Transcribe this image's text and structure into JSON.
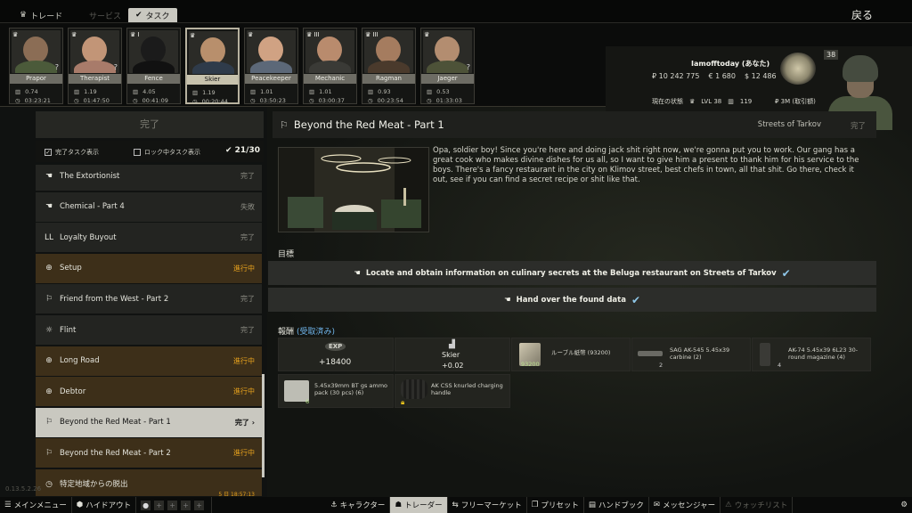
{
  "topbar": {
    "tabs": [
      {
        "label": "トレード",
        "state": "normal"
      },
      {
        "label": "サービス",
        "state": "dim"
      },
      {
        "label": "タスク",
        "state": "active"
      }
    ],
    "back_label": "戻る"
  },
  "traders": [
    {
      "name": "Prapor",
      "rep": "0.74",
      "timer": "03:23:21",
      "skin": "#8b6d55",
      "cloth": "#4b5a3a",
      "level": "",
      "question": "?"
    },
    {
      "name": "Therapist",
      "rep": "1.19",
      "timer": "01:47:50",
      "skin": "#c29577",
      "cloth": "#a87b6a",
      "level": "",
      "question": "?"
    },
    {
      "name": "Fence",
      "rep": "4.05",
      "timer": "00:41:09",
      "skin": "#1b1b1b",
      "cloth": "#111111",
      "level": "I",
      "question": ""
    },
    {
      "name": "Skier",
      "rep": "1.19",
      "timer": "00:20:44",
      "skin": "#b88f6c",
      "cloth": "#2f3b4a",
      "level": "",
      "question": ""
    },
    {
      "name": "Peacekeeper",
      "rep": "1.01",
      "timer": "03:50:23",
      "skin": "#d0a283",
      "cloth": "#5c6878",
      "level": "",
      "question": ""
    },
    {
      "name": "Mechanic",
      "rep": "1.01",
      "timer": "03:00:37",
      "skin": "#b98b6d",
      "cloth": "#3a3a36",
      "level": "III",
      "question": ""
    },
    {
      "name": "Ragman",
      "rep": "0.93",
      "timer": "00:23:54",
      "skin": "#a57c5f",
      "cloth": "#4a3a2c",
      "level": "III",
      "question": ""
    },
    {
      "name": "Jaeger",
      "rep": "0.53",
      "timer": "01:33:03",
      "skin": "#b38d70",
      "cloth": "#4d5238",
      "level": "",
      "question": "?"
    }
  ],
  "profile": {
    "name": "Iamofftoday (あなた)",
    "roubles": "₽ 10 242 775",
    "euros": "€ 1 680",
    "dollars": "$ 12 486",
    "status_label": "現在の状態",
    "level_label": "LVL 38",
    "rep": "119",
    "trader_xp": "₽ 3M (取引額)",
    "level_badge": "38"
  },
  "left_panel": {
    "header": "完了",
    "filter_completed": "完了タスク表示",
    "filter_locked": "ロック中タスク表示",
    "count": "21/30",
    "quests": [
      {
        "name": "The Extortionist",
        "status": "完了",
        "icon": "hand-icon",
        "glyph": "☚",
        "state": "normal",
        "timer": ""
      },
      {
        "name": "Chemical - Part 4",
        "status": "失敗",
        "icon": "hand-icon",
        "glyph": "☚",
        "state": "normal",
        "timer": ""
      },
      {
        "name": "Loyalty Buyout",
        "status": "完了",
        "icon": "loyalty-icon",
        "glyph": "LL",
        "state": "normal",
        "timer": ""
      },
      {
        "name": "Setup",
        "status": "進行中",
        "icon": "crosshair-icon",
        "glyph": "⊕",
        "state": "active",
        "timer": ""
      },
      {
        "name": "Friend from the West - Part 2",
        "status": "完了",
        "icon": "person-icon",
        "glyph": "⚐",
        "state": "normal",
        "timer": ""
      },
      {
        "name": "Flint",
        "status": "完了",
        "icon": "light-icon",
        "glyph": "☼",
        "state": "normal",
        "timer": ""
      },
      {
        "name": "Long Road",
        "status": "進行中",
        "icon": "crosshair-icon",
        "glyph": "⊕",
        "state": "active",
        "timer": ""
      },
      {
        "name": "Debtor",
        "status": "進行中",
        "icon": "crosshair-icon",
        "glyph": "⊕",
        "state": "active",
        "timer": ""
      },
      {
        "name": "Beyond the Red Meat - Part 1",
        "status": "完了 ›",
        "icon": "runner-icon",
        "glyph": "⚐",
        "state": "selected",
        "timer": ""
      },
      {
        "name": "Beyond the Red Meat - Part 2",
        "status": "進行中",
        "icon": "runner-icon",
        "glyph": "⚐",
        "state": "active",
        "timer": ""
      },
      {
        "name": "特定地域からの脱出",
        "status": "",
        "icon": "clock-icon",
        "glyph": "◷",
        "state": "active",
        "timer": "5 日 18:57:13"
      }
    ]
  },
  "detail": {
    "title": "Beyond the Red Meat - Part 1",
    "location": "Streets of Tarkov",
    "status": "完了",
    "description": "Opa, soldier boy! Since you're here and doing jack shit right now, we're gonna put you to work. Our gang has a great cook who makes divine dishes for us all, so I want to give him a present to thank him for his service to the boys. There's a fancy restaurant in the city on Klimov street, best chefs in town, all that shit. Go there, check it out, see if you can find a secret recipe or shit like that.",
    "objectives_label": "目標",
    "objectives": [
      "Locate and obtain information on culinary secrets at the Beluga restaurant on Streets of Tarkov",
      "Hand over the found data"
    ],
    "rewards_label": "報酬",
    "rewards_received": "(受取済み)",
    "rewards": {
      "exp_badge": "EXP",
      "exp_value": "+18400",
      "trader_name": "Skier",
      "trader_rep": "+0.02",
      "roubles": "ルーブル紙幣 (93200)",
      "roubles_count": "93200",
      "ak545": "SAG AK-545 5.45x39 carbine (2)",
      "ak545_count": "2",
      "mag": "AK-74 5.45x39 6L23 30-round magazine (4)",
      "mag_count": "4",
      "ammo": "5.45x39mm BT gs ammo pack (30 pcs) (6)",
      "ammo_count": "6",
      "handle": "AK CSS knurled charging handle"
    }
  },
  "bottombar": {
    "main_menu": "メインメニュー",
    "hideout": "ハイドアウト",
    "character": "キャラクター",
    "traders": "トレーダー",
    "flea": "フリーマーケット",
    "presets": "プリセット",
    "handbook": "ハンドブック",
    "messenger": "メッセンジャー",
    "watchlist": "ウォッチリスト",
    "clock": "0.13.5.2.26"
  }
}
